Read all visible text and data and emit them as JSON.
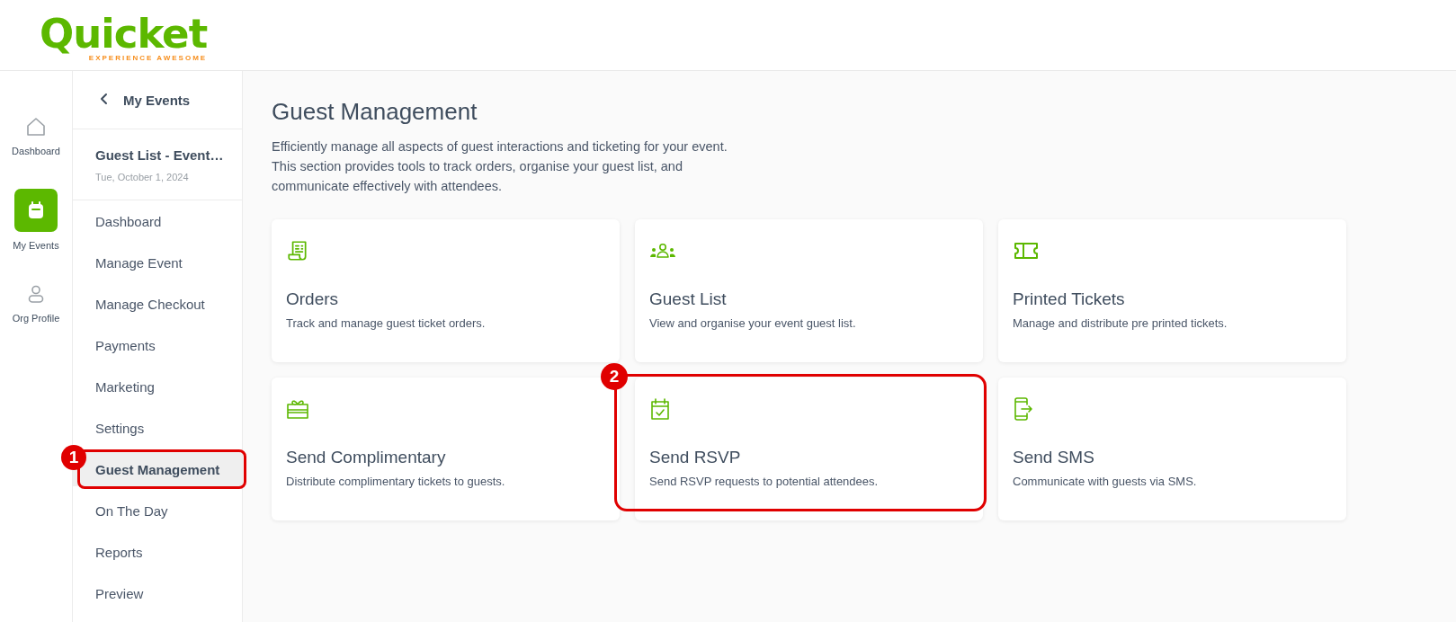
{
  "header": {
    "logo": {
      "word": "Quicket",
      "tagline": "EXPERIENCE AWESOME"
    }
  },
  "rail": [
    {
      "label": "Dashboard",
      "selected": false
    },
    {
      "label": "My Events",
      "selected": true
    },
    {
      "label": "Org Profile",
      "selected": false
    }
  ],
  "sidebar": {
    "back": "My Events",
    "event_title": "Guest List - Event…",
    "event_date": "Tue, October 1, 2024",
    "items": [
      {
        "label": "Dashboard",
        "selected": false
      },
      {
        "label": "Manage Event",
        "selected": false
      },
      {
        "label": "Manage Checkout",
        "selected": false
      },
      {
        "label": "Payments",
        "selected": false
      },
      {
        "label": "Marketing",
        "selected": false
      },
      {
        "label": "Settings",
        "selected": false
      },
      {
        "label": "Guest Management",
        "selected": true,
        "callout": "1"
      },
      {
        "label": "On The Day",
        "selected": false
      },
      {
        "label": "Reports",
        "selected": false
      },
      {
        "label": "Preview",
        "selected": false
      }
    ]
  },
  "main": {
    "title": "Guest Management",
    "description": "Efficiently manage all aspects of guest interactions and ticketing for your event. This section provides tools to track orders, organise your guest list, and communicate effectively with attendees.",
    "cards": [
      {
        "title": "Orders",
        "text": "Track and manage guest ticket orders."
      },
      {
        "title": "Guest List",
        "text": "View and organise your event guest list."
      },
      {
        "title": "Printed Tickets",
        "text": "Manage and distribute pre printed tickets."
      },
      {
        "title": "Send Complimentary",
        "text": "Distribute complimentary tickets to guests."
      },
      {
        "title": "Send RSVP",
        "text": "Send RSVP requests to potential attendees.",
        "callout": "2"
      },
      {
        "title": "Send SMS",
        "text": "Communicate with guests via SMS."
      }
    ]
  }
}
